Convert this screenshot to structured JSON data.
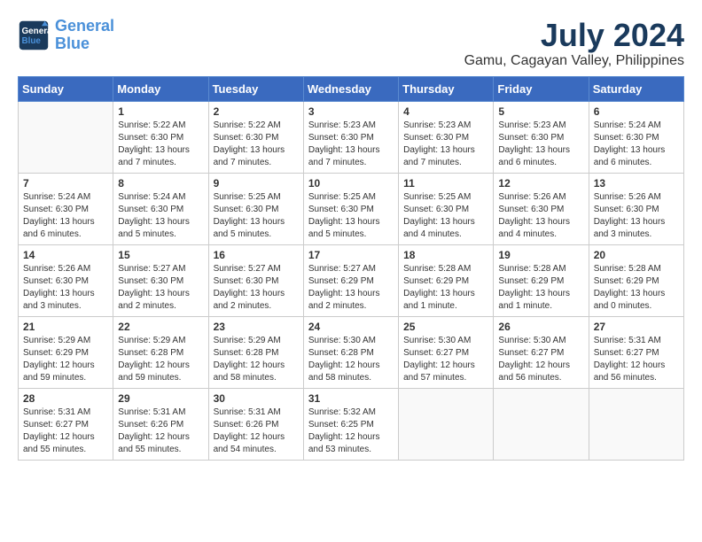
{
  "logo": {
    "line1": "General",
    "line2": "Blue"
  },
  "title": "July 2024",
  "subtitle": "Gamu, Cagayan Valley, Philippines",
  "days_of_week": [
    "Sunday",
    "Monday",
    "Tuesday",
    "Wednesday",
    "Thursday",
    "Friday",
    "Saturday"
  ],
  "weeks": [
    [
      {
        "day": "",
        "info": ""
      },
      {
        "day": "1",
        "info": "Sunrise: 5:22 AM\nSunset: 6:30 PM\nDaylight: 13 hours\nand 7 minutes."
      },
      {
        "day": "2",
        "info": "Sunrise: 5:22 AM\nSunset: 6:30 PM\nDaylight: 13 hours\nand 7 minutes."
      },
      {
        "day": "3",
        "info": "Sunrise: 5:23 AM\nSunset: 6:30 PM\nDaylight: 13 hours\nand 7 minutes."
      },
      {
        "day": "4",
        "info": "Sunrise: 5:23 AM\nSunset: 6:30 PM\nDaylight: 13 hours\nand 7 minutes."
      },
      {
        "day": "5",
        "info": "Sunrise: 5:23 AM\nSunset: 6:30 PM\nDaylight: 13 hours\nand 6 minutes."
      },
      {
        "day": "6",
        "info": "Sunrise: 5:24 AM\nSunset: 6:30 PM\nDaylight: 13 hours\nand 6 minutes."
      }
    ],
    [
      {
        "day": "7",
        "info": "Sunrise: 5:24 AM\nSunset: 6:30 PM\nDaylight: 13 hours\nand 6 minutes."
      },
      {
        "day": "8",
        "info": "Sunrise: 5:24 AM\nSunset: 6:30 PM\nDaylight: 13 hours\nand 5 minutes."
      },
      {
        "day": "9",
        "info": "Sunrise: 5:25 AM\nSunset: 6:30 PM\nDaylight: 13 hours\nand 5 minutes."
      },
      {
        "day": "10",
        "info": "Sunrise: 5:25 AM\nSunset: 6:30 PM\nDaylight: 13 hours\nand 5 minutes."
      },
      {
        "day": "11",
        "info": "Sunrise: 5:25 AM\nSunset: 6:30 PM\nDaylight: 13 hours\nand 4 minutes."
      },
      {
        "day": "12",
        "info": "Sunrise: 5:26 AM\nSunset: 6:30 PM\nDaylight: 13 hours\nand 4 minutes."
      },
      {
        "day": "13",
        "info": "Sunrise: 5:26 AM\nSunset: 6:30 PM\nDaylight: 13 hours\nand 3 minutes."
      }
    ],
    [
      {
        "day": "14",
        "info": "Sunrise: 5:26 AM\nSunset: 6:30 PM\nDaylight: 13 hours\nand 3 minutes."
      },
      {
        "day": "15",
        "info": "Sunrise: 5:27 AM\nSunset: 6:30 PM\nDaylight: 13 hours\nand 2 minutes."
      },
      {
        "day": "16",
        "info": "Sunrise: 5:27 AM\nSunset: 6:30 PM\nDaylight: 13 hours\nand 2 minutes."
      },
      {
        "day": "17",
        "info": "Sunrise: 5:27 AM\nSunset: 6:29 PM\nDaylight: 13 hours\nand 2 minutes."
      },
      {
        "day": "18",
        "info": "Sunrise: 5:28 AM\nSunset: 6:29 PM\nDaylight: 13 hours\nand 1 minute."
      },
      {
        "day": "19",
        "info": "Sunrise: 5:28 AM\nSunset: 6:29 PM\nDaylight: 13 hours\nand 1 minute."
      },
      {
        "day": "20",
        "info": "Sunrise: 5:28 AM\nSunset: 6:29 PM\nDaylight: 13 hours\nand 0 minutes."
      }
    ],
    [
      {
        "day": "21",
        "info": "Sunrise: 5:29 AM\nSunset: 6:29 PM\nDaylight: 12 hours\nand 59 minutes."
      },
      {
        "day": "22",
        "info": "Sunrise: 5:29 AM\nSunset: 6:28 PM\nDaylight: 12 hours\nand 59 minutes."
      },
      {
        "day": "23",
        "info": "Sunrise: 5:29 AM\nSunset: 6:28 PM\nDaylight: 12 hours\nand 58 minutes."
      },
      {
        "day": "24",
        "info": "Sunrise: 5:30 AM\nSunset: 6:28 PM\nDaylight: 12 hours\nand 58 minutes."
      },
      {
        "day": "25",
        "info": "Sunrise: 5:30 AM\nSunset: 6:27 PM\nDaylight: 12 hours\nand 57 minutes."
      },
      {
        "day": "26",
        "info": "Sunrise: 5:30 AM\nSunset: 6:27 PM\nDaylight: 12 hours\nand 56 minutes."
      },
      {
        "day": "27",
        "info": "Sunrise: 5:31 AM\nSunset: 6:27 PM\nDaylight: 12 hours\nand 56 minutes."
      }
    ],
    [
      {
        "day": "28",
        "info": "Sunrise: 5:31 AM\nSunset: 6:27 PM\nDaylight: 12 hours\nand 55 minutes."
      },
      {
        "day": "29",
        "info": "Sunrise: 5:31 AM\nSunset: 6:26 PM\nDaylight: 12 hours\nand 55 minutes."
      },
      {
        "day": "30",
        "info": "Sunrise: 5:31 AM\nSunset: 6:26 PM\nDaylight: 12 hours\nand 54 minutes."
      },
      {
        "day": "31",
        "info": "Sunrise: 5:32 AM\nSunset: 6:25 PM\nDaylight: 12 hours\nand 53 minutes."
      },
      {
        "day": "",
        "info": ""
      },
      {
        "day": "",
        "info": ""
      },
      {
        "day": "",
        "info": ""
      }
    ]
  ]
}
